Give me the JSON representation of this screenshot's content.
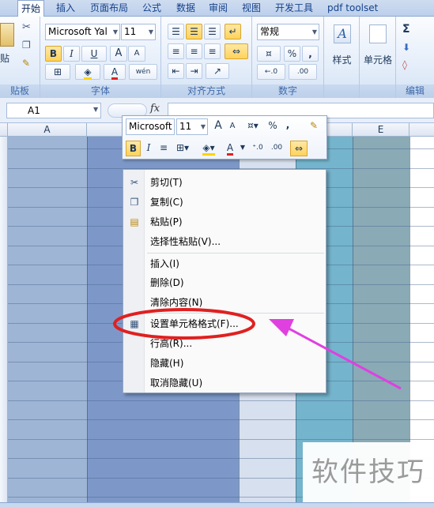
{
  "tabs": [
    "开始",
    "插入",
    "页面布局",
    "公式",
    "数据",
    "审阅",
    "视图",
    "开发工具",
    "pdf toolset"
  ],
  "ribbon": {
    "clipboard": {
      "paste_label": "贴",
      "label": "贴板"
    },
    "font": {
      "name": "Microsoft Yal",
      "size": "11",
      "label": "字体",
      "bold": "B",
      "italic": "I",
      "underline": "U",
      "grow": "A",
      "shrink": "A",
      "color_a": "A",
      "wen": "wén"
    },
    "alignment": {
      "label": "对齐方式"
    },
    "number": {
      "format": "常规",
      "label": "数字",
      "percent": "%",
      "comma": ",",
      "inc": "←.0",
      "dec": ".00"
    },
    "styles": {
      "label": "样式"
    },
    "cells": {
      "label": "单元格"
    },
    "editing": {
      "sigma": "Σ",
      "label": "编辑"
    }
  },
  "formula_bar": {
    "name_box": "A1",
    "fx": "fx",
    "value": ""
  },
  "columns": [
    "A",
    "",
    "",
    "",
    "E"
  ],
  "mini_toolbar": {
    "font": "Microsoft",
    "size": "11",
    "bold": "B",
    "italic": "I",
    "percent": "%",
    "comma": ",",
    "grow": "A",
    "shrink": "A",
    "color_a": "A"
  },
  "menu_items": [
    {
      "label": "剪切(T)",
      "icon": "scissors-icon"
    },
    {
      "label": "复制(C)",
      "icon": "copy-icon"
    },
    {
      "label": "粘贴(P)",
      "icon": "paste-icon"
    },
    {
      "label": "选择性粘贴(V)..."
    },
    {
      "label": "插入(I)"
    },
    {
      "label": "删除(D)"
    },
    {
      "label": "清除内容(N)"
    },
    {
      "label": "设置单元格格式(F)...",
      "icon": "format-cells-icon"
    },
    {
      "label": "行高(R)..."
    },
    {
      "label": "隐藏(H)"
    },
    {
      "label": "取消隐藏(U)"
    }
  ],
  "watermark": "软件技巧",
  "colors": {
    "col_a": "#9fb5d5",
    "col_b": "#7d98c8",
    "col_c": "#d7e0ee",
    "col_d": "#74b4cc",
    "col_e": "#8aaab6",
    "annotation": "#e02020",
    "arrow": "#e040e0"
  }
}
